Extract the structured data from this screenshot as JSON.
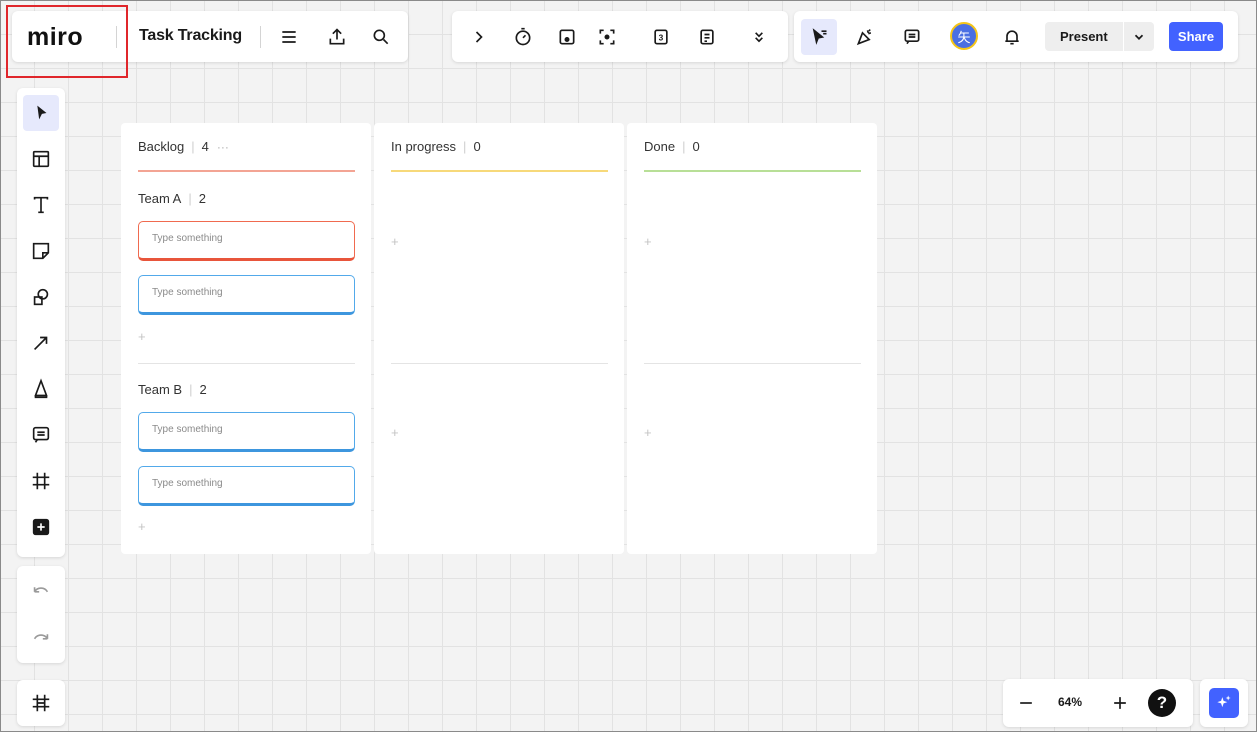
{
  "header": {
    "logo": "miro",
    "board_name": "Task Tracking"
  },
  "top_right": {
    "avatar_initial": "矢",
    "present_label": "Present",
    "share_label": "Share"
  },
  "toolbar_center": {
    "date_badge": "3"
  },
  "board": {
    "columns": [
      {
        "title": "Backlog",
        "count": "4",
        "more": "···"
      },
      {
        "title": "In progress",
        "count": "0"
      },
      {
        "title": "Done",
        "count": "0"
      }
    ],
    "groups": [
      {
        "title": "Team A",
        "count": "2"
      },
      {
        "title": "Team B",
        "count": "2"
      }
    ],
    "card_placeholder": "Type something",
    "add_symbol": "+"
  },
  "colors": {
    "backlog_line": "#f3a494",
    "in_progress_line": "#f7d97a",
    "done_line": "#b8df97",
    "accent": "#4262ff"
  },
  "zoom": {
    "level": "64%",
    "help": "?"
  }
}
